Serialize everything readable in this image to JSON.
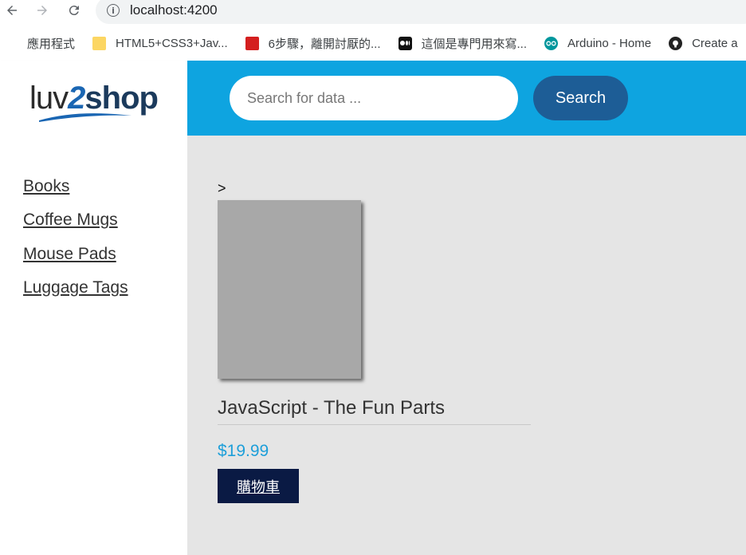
{
  "browser": {
    "url": "localhost:4200",
    "bookmarks": [
      {
        "label": "應用程式",
        "icon": "apps-grid-icon"
      },
      {
        "label": "HTML5+CSS3+Jav...",
        "icon": "folder-icon"
      },
      {
        "label": "6步驟，離開討厭的...",
        "icon": "site-icon-red"
      },
      {
        "label": "這個是專門用來寫...",
        "icon": "medium-icon"
      },
      {
        "label": "Arduino - Home",
        "icon": "arduino-icon"
      },
      {
        "label": "Create a",
        "icon": "github-icon"
      }
    ]
  },
  "logo": {
    "part1": "luv",
    "part2": "2",
    "part3": "shop"
  },
  "search": {
    "placeholder": "Search for data ...",
    "button_label": "Search"
  },
  "sidebar": {
    "items": [
      {
        "label": "Books"
      },
      {
        "label": "Coffee Mugs"
      },
      {
        "label": "Mouse Pads"
      },
      {
        "label": "Luggage Tags"
      }
    ]
  },
  "main": {
    "prefix": ">",
    "product": {
      "title": "JavaScript - The Fun Parts",
      "price": "$19.99",
      "cart_label": "購物車"
    }
  },
  "colors": {
    "header_blue": "#0ea4e0",
    "search_button": "#1d5d96",
    "price": "#1e9fd9",
    "cart_button": "#0a1a44"
  }
}
